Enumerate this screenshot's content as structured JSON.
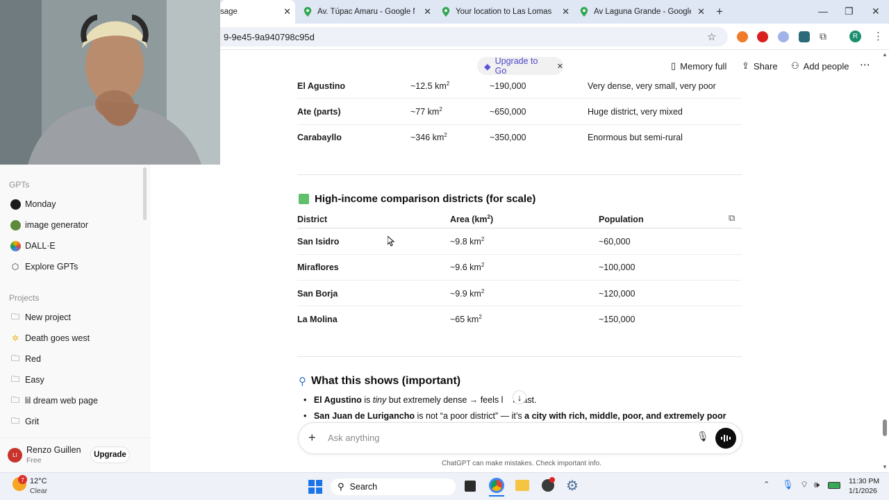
{
  "browser": {
    "tabs": [
      {
        "label": "sage",
        "active": true
      },
      {
        "label": "Av. Túpac Amaru - Google Map",
        "active": false
      },
      {
        "label": "Your location to Las Lomas De",
        "active": false
      },
      {
        "label": "Av Laguna Grande - Google Ma",
        "active": false
      }
    ],
    "url": "9-9e45-9a940798c95d",
    "profile_initial": "R"
  },
  "sidebar": {
    "gpts_heading": "GPTs",
    "gpts": [
      {
        "label": "Monday",
        "icon": "monday-icon"
      },
      {
        "label": "image generator",
        "icon": "image-generator-icon"
      },
      {
        "label": "DALL·E",
        "icon": "dalle-icon"
      },
      {
        "label": "Explore GPTs",
        "icon": "explore-gpts-icon"
      }
    ],
    "projects_heading": "Projects",
    "projects": [
      {
        "label": "New project",
        "icon": "folder-plus-icon"
      },
      {
        "label": "Death goes west",
        "icon": "sparkle-icon"
      },
      {
        "label": "Red",
        "icon": "folder-icon"
      },
      {
        "label": "Easy",
        "icon": "folder-icon"
      },
      {
        "label": "lil dream web page",
        "icon": "folder-icon"
      },
      {
        "label": "Grit",
        "icon": "folder-icon"
      }
    ],
    "user": {
      "name": "Renzo Guillen",
      "plan": "Free",
      "initials": "LI",
      "upgrade_label": "Upgrade"
    }
  },
  "header": {
    "upgrade_go": "Upgrade to Go",
    "memory": "Memory full",
    "share": "Share",
    "add_people": "Add people"
  },
  "table1": {
    "rows": [
      {
        "district": "El Agustino",
        "area": "~12.5 km",
        "population": "~190,000",
        "note": "Very dense, very small, very poor"
      },
      {
        "district": "Ate (parts)",
        "area": "~77 km",
        "population": "~650,000",
        "note": "Huge district, very mixed"
      },
      {
        "district": "Carabayllo",
        "area": "~346 km",
        "population": "~350,000",
        "note": "Enormous but semi-rural"
      }
    ]
  },
  "section2": {
    "emoji": "🟩",
    "title": "High-income comparison districts (for scale)",
    "columns": [
      "District",
      "Area (km",
      "Population"
    ],
    "rows": [
      {
        "district": "San Isidro",
        "area": "~9.8 km",
        "population": "~60,000"
      },
      {
        "district": "Miraflores",
        "area": "~9.6 km",
        "population": "~100,000"
      },
      {
        "district": "San Borja",
        "area": "~9.9 km",
        "population": "~120,000"
      },
      {
        "district": "La Molina",
        "area": "~65 km",
        "population": "~150,000"
      }
    ]
  },
  "section3": {
    "emoji": "🔍",
    "title": "What this shows (important)",
    "bullet1": {
      "bold": "El Agustino",
      "is": " is ",
      "italic": "tiny",
      "rest": " but extremely dense → feels l",
      "tail": "n fast."
    },
    "bullet2": {
      "bold": "San Juan de Lurigancho",
      "mid": " is not “a poor district” — it’s ",
      "bold2": "a city with rich, middle, poor, and extremely poor"
    }
  },
  "composer": {
    "placeholder": "Ask anything",
    "disclaimer": "ChatGPT can make mistakes. Check important info."
  },
  "taskbar": {
    "weather_temp": "12°C",
    "weather_desc": "Clear",
    "weather_badge": "7",
    "search_label": "Search",
    "time": "11:30 PM",
    "date": "1/1/2026"
  }
}
